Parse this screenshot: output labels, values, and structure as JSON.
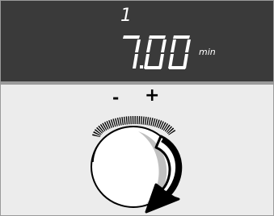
{
  "display": {
    "program_number": "1",
    "time_value": "7.00",
    "unit": "min"
  },
  "control": {
    "decrease_label": "-",
    "increase_label": "+",
    "rotation": "clockwise"
  },
  "colors": {
    "display_background": "#3a3a3a",
    "display_text": "#ffffff",
    "panel_background": "#ececec",
    "knob_shade": "#c0c0c0"
  },
  "icons": [
    "rotary-knob-icon",
    "clockwise-arrow-icon"
  ]
}
